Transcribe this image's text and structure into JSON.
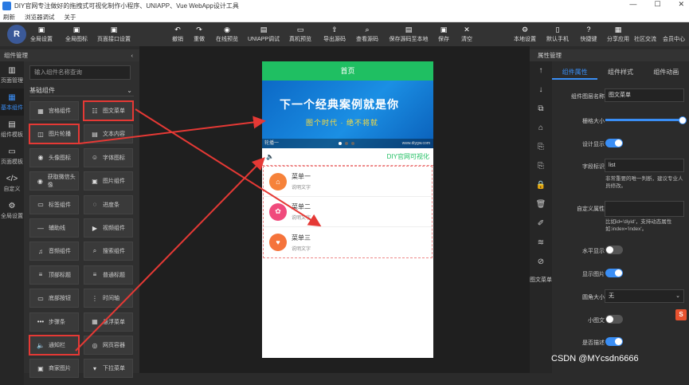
{
  "window": {
    "title": "DIY官网专注做好的拖拽式可视化制作小程序、UNIAPP、Vue WebApp设计工具",
    "controls": [
      "—",
      "☐",
      "✕"
    ]
  },
  "menubar": [
    "刷新",
    "浏览器调试",
    "关于"
  ],
  "toolbar": {
    "logo": "R",
    "left": [
      {
        "label": "全局设置",
        "icon": "▣"
      },
      {
        "label": "全局图标",
        "icon": "▣"
      },
      {
        "label": "页面接口设置",
        "icon": "▣"
      }
    ],
    "middle": [
      {
        "label": "撤销",
        "icon": "↶"
      },
      {
        "label": "重做",
        "icon": "↷"
      },
      {
        "label": "在线预览",
        "icon": "◉"
      },
      {
        "label": "UNIAPP调试",
        "icon": "▤"
      },
      {
        "label": "真机预览",
        "icon": "▭"
      },
      {
        "label": "导出源码",
        "icon": "⇪"
      },
      {
        "label": "查看源码",
        "icon": "⌕"
      },
      {
        "label": "保存源码至本地",
        "icon": "▤"
      },
      {
        "label": "保存",
        "icon": "▣"
      },
      {
        "label": "清空",
        "icon": "✕"
      }
    ],
    "right": [
      {
        "label": "本地设置",
        "icon": "⚙"
      },
      {
        "label": "默认手机",
        "icon": "▯"
      },
      {
        "label": "快捷键",
        "icon": "?"
      },
      {
        "label": "分享应用",
        "icon": "▦"
      },
      {
        "label": "社区交流",
        "icon": ""
      },
      {
        "label": "会员中心",
        "icon": ""
      }
    ]
  },
  "left_panel": {
    "header": "组件管理",
    "rail": [
      {
        "label": "页面管理",
        "icon": "▥"
      },
      {
        "label": "基本组件",
        "icon": "▦"
      },
      {
        "label": "组件模板",
        "icon": "▤"
      },
      {
        "label": "页面模板",
        "icon": "▭"
      },
      {
        "label": "自定义",
        "icon": "</>"
      },
      {
        "label": "全局设置",
        "icon": "⚙"
      }
    ],
    "search_placeholder": "输入组件名称查询",
    "group": "基础组件",
    "components": [
      {
        "label": "宫格组件",
        "icon": "▦"
      },
      {
        "label": "图文菜单",
        "icon": "☷"
      },
      {
        "label": "图片轮播",
        "icon": "◫"
      },
      {
        "label": "文本内容",
        "icon": "▤"
      },
      {
        "label": "头像图标",
        "icon": "◉"
      },
      {
        "label": "字体图标",
        "icon": "☺"
      },
      {
        "label": "获取微信头像",
        "icon": "◉"
      },
      {
        "label": "图片组件",
        "icon": "▣"
      },
      {
        "label": "标签组件",
        "icon": "▭"
      },
      {
        "label": "进度条",
        "icon": "◌"
      },
      {
        "label": "辅助线",
        "icon": "—"
      },
      {
        "label": "视频组件",
        "icon": "▶"
      },
      {
        "label": "音频组件",
        "icon": "♫"
      },
      {
        "label": "搜索组件",
        "icon": "⌕"
      },
      {
        "label": "顶部标题",
        "icon": "≡"
      },
      {
        "label": "普通标题",
        "icon": "≡"
      },
      {
        "label": "底部按钮",
        "icon": "▭"
      },
      {
        "label": "时间轴",
        "icon": "⋮"
      },
      {
        "label": "步骤条",
        "icon": "•••"
      },
      {
        "label": "悬浮菜单",
        "icon": "▦"
      },
      {
        "label": "通知栏",
        "icon": "🔈"
      },
      {
        "label": "网页容器",
        "icon": "◎"
      },
      {
        "label": "商家图片",
        "icon": "▣"
      },
      {
        "label": "下拉菜单",
        "icon": "▾"
      }
    ]
  },
  "preview": {
    "page_title": "首页",
    "banner": {
      "title": "下一个经典案例就是你",
      "subtitle": "图个时代 · 绝不将就",
      "caption": "轮播一",
      "watermark": "www.diygw.com"
    },
    "notice": {
      "icon": "🔈",
      "text": "DIY官网可视化"
    },
    "menu": [
      {
        "title": "菜单一",
        "subtitle": "说明文字",
        "icon": "⌂",
        "color": "#f6823a"
      },
      {
        "title": "菜单二",
        "subtitle": "说明文字",
        "icon": "✿",
        "color": "#f04a7c"
      },
      {
        "title": "菜单三",
        "subtitle": "说明文字",
        "icon": "♥",
        "color": "#f5733b"
      }
    ]
  },
  "right_panel": {
    "header": "属性管理",
    "tabs": [
      "组件属性",
      "组件样式",
      "组件动画"
    ],
    "rail_icons": [
      "↑",
      "↓",
      "⧉",
      "⌂",
      "⎘",
      "⎘",
      "🔒",
      "🗑",
      "✐",
      "≋",
      "⊘"
    ],
    "rail_label": "图文菜单",
    "fields": {
      "name_label": "组件图层名称",
      "name_value": "图文菜单",
      "size_label": "栅格大小",
      "size_value": 1,
      "show_label": "设计显示",
      "id_label": "字段标识",
      "id_value": "list",
      "id_hint": "非常重要的唯一判断，建议专业人员修改。",
      "custom_label": "自定义属性",
      "custom_hint": "比如id='diyid'，支持动态属性如:index='index'。",
      "horiz_label": "水平显示",
      "img_label": "显示图片",
      "radius_label": "圆角大小",
      "radius_value": "无",
      "small_label": "小图文",
      "desc_label": "是否描述"
    }
  },
  "watermark": "CSDN @MYcsdn6666",
  "ime_icon": "S"
}
